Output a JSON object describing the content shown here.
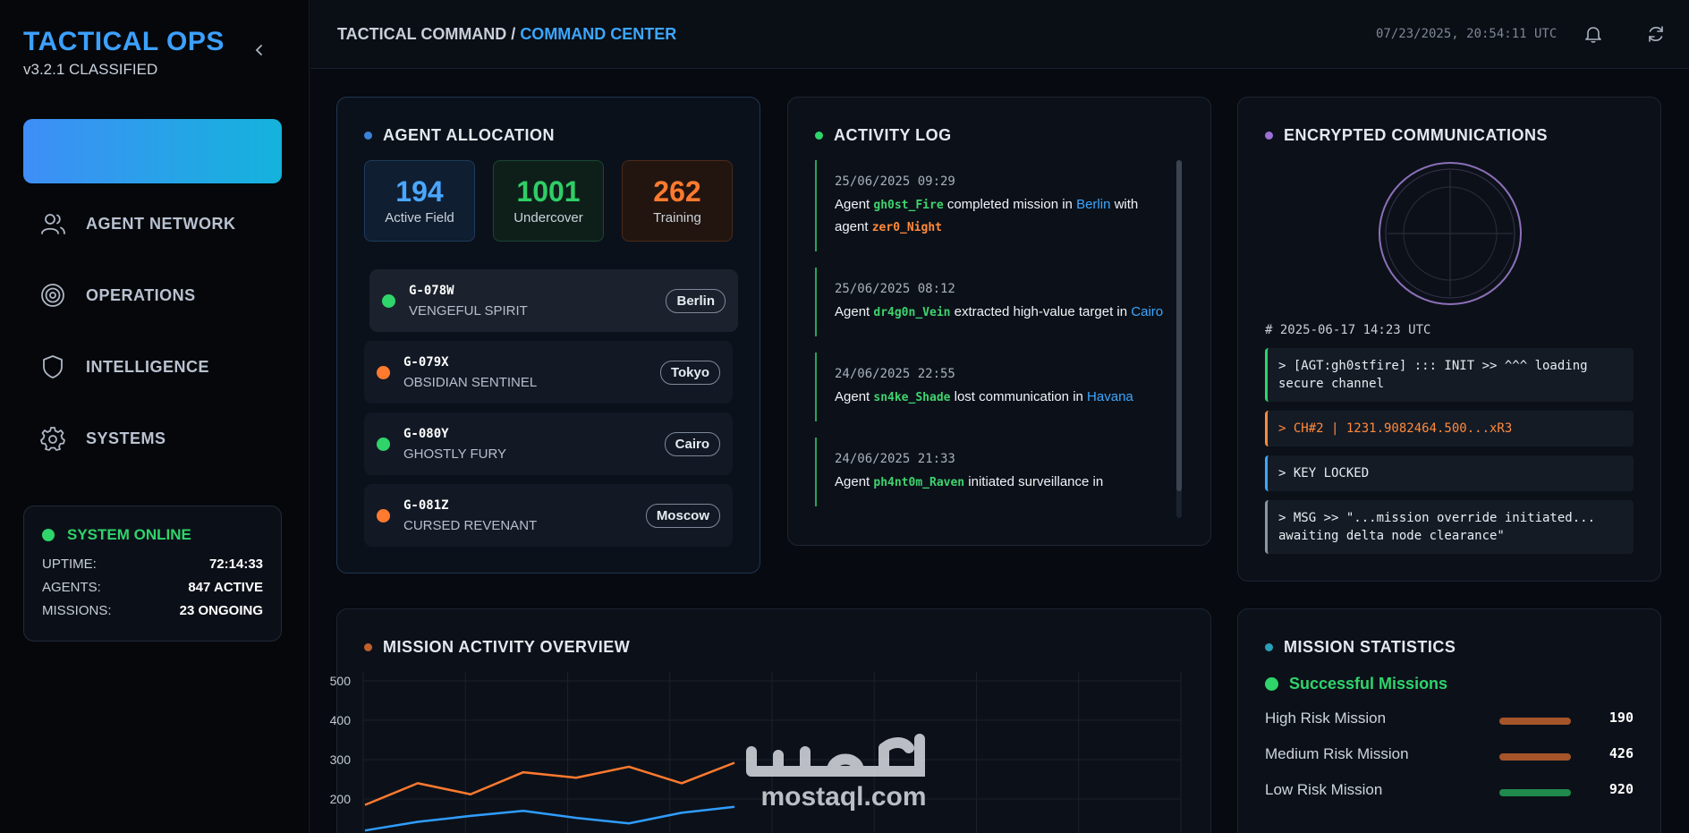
{
  "brand": {
    "title": "TACTICAL OPS",
    "version": "v3.2.1 CLASSIFIED"
  },
  "nav": [
    {
      "label": "AGENT NETWORK",
      "icon": "users-icon"
    },
    {
      "label": "OPERATIONS",
      "icon": "target-icon"
    },
    {
      "label": "INTELLIGENCE",
      "icon": "shield-icon"
    },
    {
      "label": "SYSTEMS",
      "icon": "gear-icon"
    }
  ],
  "system": {
    "status": "SYSTEM ONLINE",
    "rows": [
      {
        "label": "UPTIME:",
        "value": "72:14:33"
      },
      {
        "label": "AGENTS:",
        "value": "847 ACTIVE"
      },
      {
        "label": "MISSIONS:",
        "value": "23 ONGOING"
      }
    ]
  },
  "header": {
    "crumb_root": "TACTICAL COMMAND / ",
    "crumb_current": "COMMAND CENTER",
    "clock": "07/23/2025, 20:54:11 UTC"
  },
  "allocation": {
    "title": "AGENT ALLOCATION",
    "stats": [
      {
        "value": "194",
        "label": "Active Field"
      },
      {
        "value": "1001",
        "label": "Undercover"
      },
      {
        "value": "262",
        "label": "Training"
      }
    ],
    "agents": [
      {
        "code": "G-078W",
        "name": "VENGEFUL SPIRIT",
        "city": "Berlin"
      },
      {
        "code": "G-079X",
        "name": "OBSIDIAN SENTINEL",
        "city": "Tokyo"
      },
      {
        "code": "G-080Y",
        "name": "GHOSTLY FURY",
        "city": "Cairo"
      },
      {
        "code": "G-081Z",
        "name": "CURSED REVENANT",
        "city": "Moscow"
      }
    ]
  },
  "activity": {
    "title": "ACTIVITY LOG",
    "entries": [
      {
        "ts": "25/06/2025 09:29",
        "p1": "Agent ",
        "agent": "gh0st_Fire",
        "p2": " completed mission in ",
        "place": "Berlin",
        "p3": " with agent ",
        "agent2": "zer0_Night"
      },
      {
        "ts": "25/06/2025 08:12",
        "p1": "Agent ",
        "agent": "dr4g0n_Vein",
        "p2": " extracted high-value target in ",
        "place": "Cairo",
        "p3": "",
        "agent2": ""
      },
      {
        "ts": "24/06/2025 22:55",
        "p1": "Agent ",
        "agent": "sn4ke_Shade",
        "p2": " lost communication in ",
        "place": "Havana",
        "p3": "",
        "agent2": ""
      },
      {
        "ts": "24/06/2025 21:33",
        "p1": "Agent ",
        "agent": "ph4nt0m_Raven",
        "p2": " initiated surveillance in",
        "place": "",
        "p3": "",
        "agent2": ""
      }
    ]
  },
  "comms": {
    "title": "ENCRYPTED COMMUNICATIONS",
    "timestamp": "# 2025-06-17 14:23 UTC",
    "lines": [
      {
        "text": "> [AGT:gh0stfire] ::: INIT >> ^^^ loading secure channel",
        "color": "#2fd46b"
      },
      {
        "text": "> CH#2 | 1231.9082464.500...xR3",
        "color": "#ff8a3c"
      },
      {
        "text": "> KEY LOCKED",
        "color": "#3ca7ff"
      },
      {
        "text": "> MSG >> \"...mission override initiated... awaiting delta node clearance\"",
        "color": "#8c96a4"
      }
    ]
  },
  "mission_activity": {
    "title": "MISSION ACTIVITY OVERVIEW"
  },
  "chart_data": {
    "type": "line",
    "title": "MISSION ACTIVITY OVERVIEW",
    "ylim": [
      100,
      500
    ],
    "yticks": [
      500,
      400,
      300,
      200
    ],
    "grid": true,
    "series": [
      {
        "color": "#ff7a2f",
        "values": [
          185,
          240,
          212,
          268,
          254,
          282,
          240,
          292
        ]
      },
      {
        "color": "#2f9dff",
        "values": [
          120,
          142,
          157,
          170,
          152,
          138,
          165,
          180
        ]
      }
    ]
  },
  "mission_stats": {
    "title": "MISSION STATISTICS",
    "subtitle": "Successful Missions",
    "rows": [
      {
        "label": "High Risk Mission",
        "value": "190",
        "color": "#a6542a"
      },
      {
        "label": "Medium Risk Mission",
        "value": "426",
        "color": "#a6542a"
      },
      {
        "label": "Low Risk Mission",
        "value": "920",
        "color": "#1f8a4c"
      }
    ]
  },
  "watermark": {
    "text": "mostaql.com"
  }
}
